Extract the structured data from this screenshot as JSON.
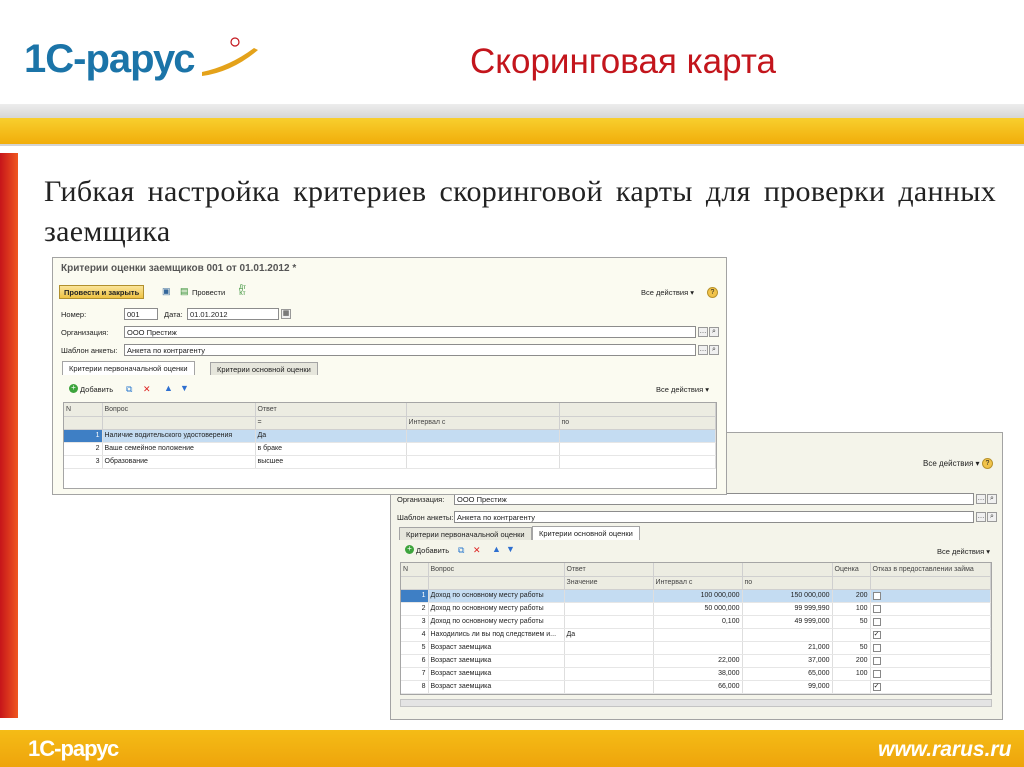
{
  "slide": {
    "logo": "1С-рарус",
    "title": "Скоринговая карта",
    "heading": "Гибкая настройка критериев скоринговой карты для проверки данных заемщика",
    "footer_logo": "1С-рарус",
    "footer_site": "www.rarus.ru",
    "colors": {
      "title": "#c3151c",
      "logo": "#1b74a8",
      "band": "#f4bd1c",
      "left_bar": "#d42d1d"
    }
  },
  "window1": {
    "title": "Критерии оценки заемщиков 001 от 01.01.2012 *",
    "btn_post_close": "Провести и закрыть",
    "btn_post": "Провести",
    "all_actions": "Все действия",
    "help": "?",
    "number_label": "Номер:",
    "number_value": "001",
    "date_label": "Дата:",
    "date_value": "01.01.2012",
    "org_label": "Организация:",
    "org_value": "ООО Престиж",
    "template_label": "Шаблон анкеты:",
    "template_value": "Анкета по контрагенту",
    "tabs": [
      "Критерии первоначальной оценки",
      "Критерии основной оценки"
    ],
    "btn_add": "Добавить",
    "table_all_actions": "Все действия",
    "columns": {
      "n": "N",
      "question": "Вопрос",
      "answer": "Ответ",
      "eq": "=",
      "interval_from": "Интервал с",
      "to": "по"
    },
    "rows": [
      {
        "n": "1",
        "question": "Наличие водительского удостоверения",
        "answer": "Да"
      },
      {
        "n": "2",
        "question": "Ваше семейное положение",
        "answer": "в браке"
      },
      {
        "n": "3",
        "question": "Образование",
        "answer": "высшее"
      }
    ]
  },
  "window2": {
    "all_actions": "Все действия",
    "help": "?",
    "org_label": "Организация:",
    "org_value": "ООО Престиж",
    "template_label": "Шаблон анкеты:",
    "template_value": "Анкета по контрагенту",
    "tabs": [
      "Критерии первоначальной оценки",
      "Критерии основной оценки"
    ],
    "btn_add": "Добавить",
    "table_all_actions": "Все действия",
    "columns": {
      "n": "N",
      "question": "Вопрос",
      "answer": "Ответ",
      "value": "Значение",
      "interval_from": "Интервал с",
      "to": "по",
      "score": "Оценка",
      "refuse": "Отказ в предоставлении займа"
    },
    "rows": [
      {
        "n": "1",
        "question": "Доход по основному месту работы",
        "value": "",
        "from": "100 000,000",
        "to": "150 000,000",
        "score": "200",
        "refuse": false
      },
      {
        "n": "2",
        "question": "Доход по основному месту работы",
        "value": "",
        "from": "50 000,000",
        "to": "99 999,990",
        "score": "100",
        "refuse": false
      },
      {
        "n": "3",
        "question": "Доход по основному месту работы",
        "value": "",
        "from": "0,100",
        "to": "49 999,000",
        "score": "50",
        "refuse": false
      },
      {
        "n": "4",
        "question": "Находились ли вы под следствием и...",
        "value": "Да",
        "from": "",
        "to": "",
        "score": "",
        "refuse": true
      },
      {
        "n": "5",
        "question": "Возраст заемщика",
        "value": "",
        "from": "",
        "to": "21,000",
        "score": "50",
        "refuse": false
      },
      {
        "n": "6",
        "question": "Возраст заемщика",
        "value": "",
        "from": "22,000",
        "to": "37,000",
        "score": "200",
        "refuse": false
      },
      {
        "n": "7",
        "question": "Возраст заемщика",
        "value": "",
        "from": "38,000",
        "to": "65,000",
        "score": "100",
        "refuse": false
      },
      {
        "n": "8",
        "question": "Возраст заемщика",
        "value": "",
        "from": "66,000",
        "to": "99,000",
        "score": "",
        "refuse": true
      }
    ]
  }
}
